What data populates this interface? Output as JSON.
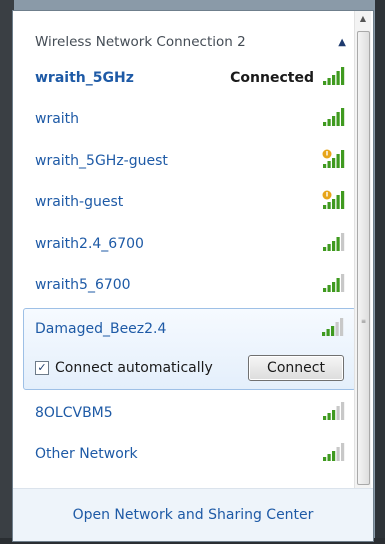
{
  "panel": {
    "title": "Wireless Network Connection 2",
    "collapse_icon": "chevron-up-icon"
  },
  "networks": [
    {
      "name": "wraith_5GHz",
      "status": "Connected",
      "signal": 5,
      "secured": true
    },
    {
      "name": "wraith",
      "signal": 5,
      "secured": true
    },
    {
      "name": "wraith_5GHz-guest",
      "signal": 5,
      "secured": false
    },
    {
      "name": "wraith-guest",
      "signal": 5,
      "secured": false
    },
    {
      "name": "wraith2.4_6700",
      "signal": 4,
      "secured": true
    },
    {
      "name": "wraith5_6700",
      "signal": 4,
      "secured": true
    },
    {
      "name": "Damaged_Beez2.4",
      "signal": 3,
      "secured": true,
      "expanded": true
    },
    {
      "name": "8OLCVBM5",
      "signal": 3,
      "secured": true
    },
    {
      "name": "Other Network",
      "signal": 3,
      "secured": true
    }
  ],
  "expanded": {
    "auto_label": "Connect automatically",
    "auto_checked": true,
    "connect_label": "Connect"
  },
  "footer": {
    "link": "Open Network and Sharing Center"
  },
  "colors": {
    "signal": "#3f9a1f",
    "signal_dim": "#c8c8c8",
    "link": "#1e5aa6",
    "warning": "#e7a51a"
  }
}
